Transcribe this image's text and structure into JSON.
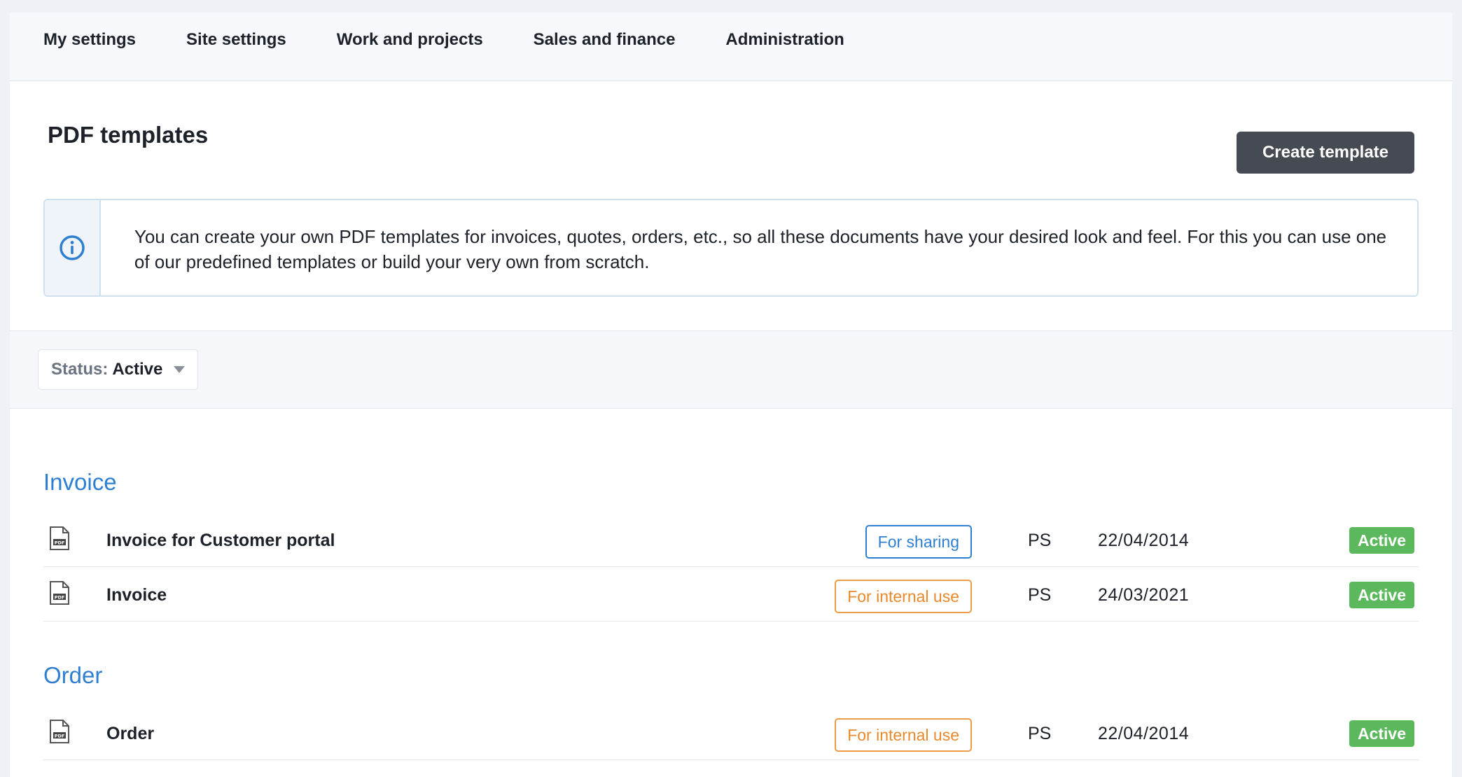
{
  "nav": {
    "items": [
      {
        "label": "My settings"
      },
      {
        "label": "Site settings"
      },
      {
        "label": "Work and projects"
      },
      {
        "label": "Sales and finance"
      },
      {
        "label": "Administration"
      }
    ]
  },
  "header": {
    "title": "PDF templates",
    "create_label": "Create template"
  },
  "info": {
    "icon": "info-circle-icon",
    "text": "You can create your own PDF templates for invoices, quotes, orders, etc., so all these documents have your desired look and feel. For this you can use one of our predefined templates or build your very own from scratch."
  },
  "filter": {
    "label": "Status:",
    "value": "Active"
  },
  "colors": {
    "accent": "#2e7fd1",
    "internal": "#e8892b",
    "active": "#5cb85c",
    "button": "#464a52"
  },
  "sections": [
    {
      "title": "Invoice",
      "rows": [
        {
          "name": "Invoice for Customer portal",
          "tag": "For sharing",
          "initials": "PS",
          "date": "22/04/2014",
          "status": "Active"
        },
        {
          "name": "Invoice",
          "tag": "For internal use",
          "initials": "PS",
          "date": "24/03/2021",
          "status": "Active"
        }
      ]
    },
    {
      "title": "Order",
      "rows": [
        {
          "name": "Order",
          "tag": "For internal use",
          "initials": "PS",
          "date": "22/04/2014",
          "status": "Active"
        }
      ]
    }
  ]
}
